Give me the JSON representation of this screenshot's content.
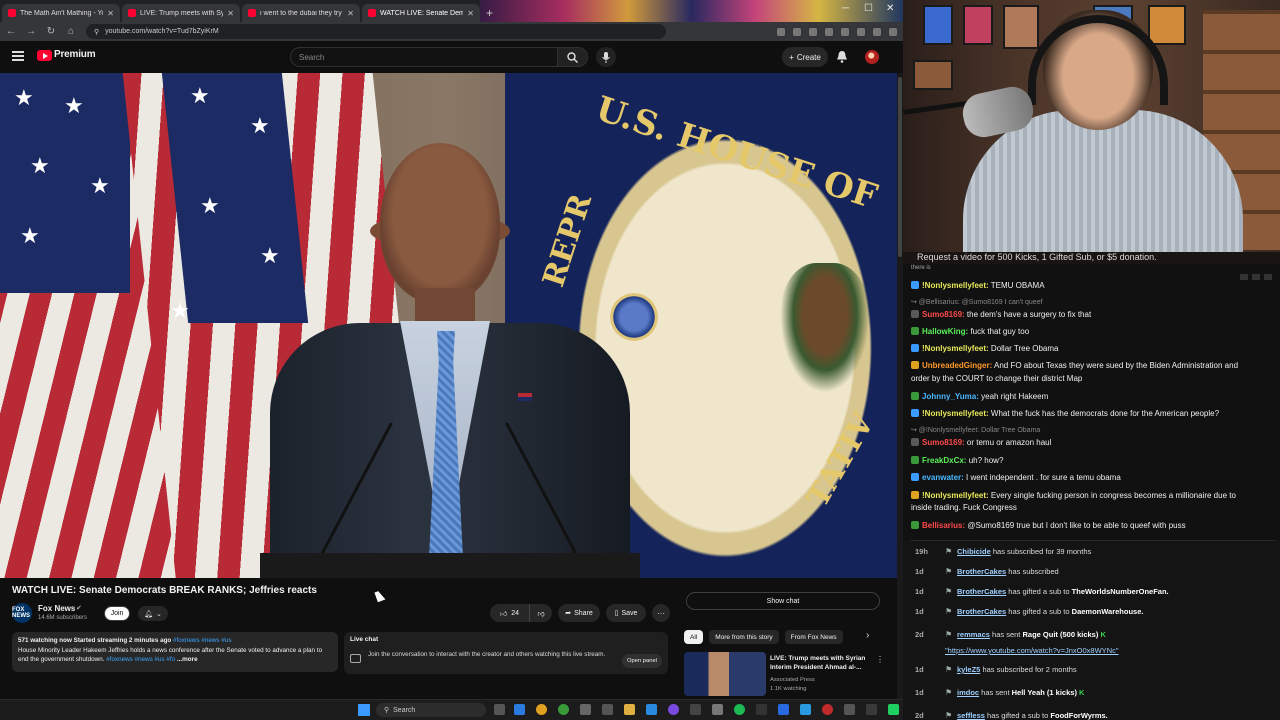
{
  "browser": {
    "tabs": [
      {
        "title": "The Math Ain't Mathing - You"
      },
      {
        "title": "LIVE: Trump meets with Syrian"
      },
      {
        "title": "i went to the dubai they try to"
      },
      {
        "title": "WATCH LIVE: Senate Demo"
      }
    ],
    "new_tab": "+",
    "url": "youtube.com/watch?v=Tud7bZyiKrM"
  },
  "youtube": {
    "logo_text": "Premium",
    "search_placeholder": "Search",
    "create_label": "Create",
    "video": {
      "title": "WATCH LIVE: Senate Democrats BREAK RANKS; Jeffries reacts",
      "seal_text": "U.S. HOUSE OF",
      "seal_text2": "REPR",
      "seal_text3": "TATIV"
    },
    "channel": {
      "name": "Fox News",
      "subscribers": "14.6M subscribers",
      "avatar_text": "FOX NEWS",
      "join_label": "Join"
    },
    "actions": {
      "likes": "24",
      "share_label": "Share",
      "save_label": "Save"
    },
    "show_chat_label": "Show chat",
    "description": {
      "meta": "571 watching now  Started streaming 2 minutes ago",
      "meta_tags": "#foxnews #news #us",
      "text": "House Minority Leader Hakeem Jeffries holds a news conference after the Senate voted to advance a plan to end the government shutdown.",
      "tags": "#foxnews #news #us #fo",
      "more": "...more"
    },
    "live_chat": {
      "title": "Live chat",
      "text": "Join the conversation to interact with the creator and others watching this live stream.",
      "open_panel": "Open panel"
    },
    "chips": [
      "All",
      "More from this story",
      "From Fox News"
    ],
    "recommendation": {
      "title": "LIVE: Trump meets with Syrian Interim President Ahmad al-...",
      "channel": "Associated Press",
      "views": "1.1K watching"
    }
  },
  "stream_overlay": {
    "banner": "Request a video for 500 Kicks, 1 Gifted Sub, or $5 donation.",
    "cut_text": "there is",
    "chat": [
      {
        "user": "!Nonlysmellyfeet:",
        "text": " TEMU OBAMA",
        "color": "#e8e85a"
      },
      {
        "reply": "@Bellisarius: @Sumo8169 I can't queef"
      },
      {
        "user": "Sumo8169:",
        "text": " the dem's have a surgery to fix that",
        "color": "#ff4a4a"
      },
      {
        "user": "HallowKing:",
        "text": " fuck that guy too",
        "color": "#5af05a"
      },
      {
        "user": "!Nonlysmellyfeet:",
        "text": " Dollar Tree Obama",
        "color": "#e8e85a"
      },
      {
        "user": "UnbreadedGinger:",
        "text": " And FO about Texas they were sued by the Biden Administration and",
        "color": "#ff9a2a"
      },
      {
        "text": "order by the COURT to change their district Map"
      },
      {
        "user": "Johnny_Yuma:",
        "text": " yeah right Hakeem",
        "color": "#4ab8ff"
      },
      {
        "user": "!Nonlysmellyfeet:",
        "text": " What the fuck has the democrats done for the American people?",
        "color": "#e8e85a"
      },
      {
        "reply": "@!Nonlysmellyfeet: Dollar Tree Obama"
      },
      {
        "user": "Sumo8169:",
        "text": " or temu or amazon haul",
        "color": "#ff4a4a"
      },
      {
        "user": "FreakDxCx:",
        "text": " uh? how?",
        "color": "#5af05a"
      },
      {
        "user": "evanwater:",
        "text": " I went independent . for sure a temu obama",
        "color": "#4ab8ff"
      },
      {
        "user": "!Nonlysmellyfeet:",
        "text": " Every single fucking person in congress becomes a millionaire due to",
        "color": "#e8e85a"
      },
      {
        "text": "inside trading. Fuck Congress"
      },
      {
        "user": "Bellisarius:",
        "text": " @Sumo8169 true but I don't like to be able to queef with puss",
        "color": "#ff4a4a"
      }
    ],
    "events": [
      {
        "time": "19h",
        "name": "Chibicide",
        "text": " has subscribed for 39 months"
      },
      {
        "time": "1d",
        "name": "BrotherCakes",
        "text": " has subscribed"
      },
      {
        "time": "1d",
        "name": "BrotherCakes",
        "text": " has gifted a sub to ",
        "target": "TheWorldsNumberOneFan."
      },
      {
        "time": "1d",
        "name": "BrotherCakes",
        "text": " has gifted a sub to ",
        "target": "DaemonWarehouse."
      },
      {
        "time": "2d",
        "name": "remmacs",
        "text": " has sent ",
        "target": "Rage Quit (500 kicks)",
        "badge": "K"
      },
      {
        "link": "https://www.youtube.com/watch?v=JnxO0x8WYNc"
      },
      {
        "time": "1d",
        "name": "kyleZ5",
        "text": " has subscribed for 2 months"
      },
      {
        "time": "1d",
        "name": "imdoc",
        "text": " has sent ",
        "target": "Hell Yeah (1 kicks)",
        "badge": "K"
      },
      {
        "time": "2d",
        "name": "seffless",
        "text": " has gifted a sub to ",
        "target": "FoodForWyrms."
      }
    ]
  },
  "taskbar": {
    "search_label": "Search"
  }
}
